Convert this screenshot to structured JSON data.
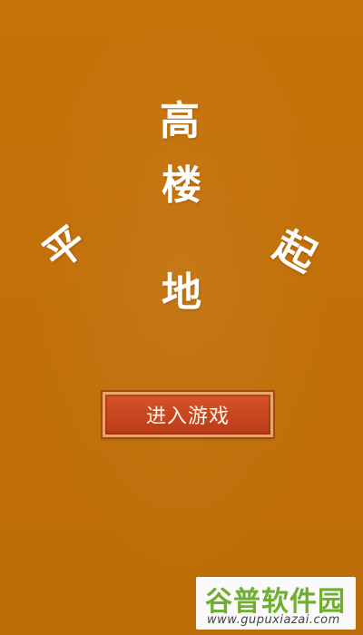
{
  "title": {
    "gao": "高",
    "lou": "楼",
    "di": "地",
    "ping": "平",
    "qi": "起"
  },
  "menu": {
    "enter_label": "进入游戏"
  },
  "watermark": {
    "logo": "谷普软件园",
    "url": "www.gupuxiazai.com"
  },
  "colors": {
    "background": "#c97408",
    "button": "#c8451f",
    "button_border": "#e6a866",
    "watermark_green": "#6fae2f"
  }
}
